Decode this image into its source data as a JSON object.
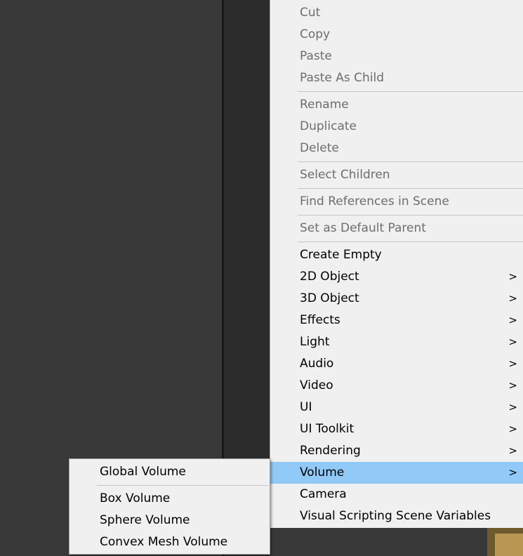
{
  "context_menu": {
    "groups": [
      [
        {
          "label": "Cut",
          "enabled": false
        },
        {
          "label": "Copy",
          "enabled": false
        },
        {
          "label": "Paste",
          "enabled": false
        },
        {
          "label": "Paste As Child",
          "enabled": false
        }
      ],
      [
        {
          "label": "Rename",
          "enabled": false
        },
        {
          "label": "Duplicate",
          "enabled": false
        },
        {
          "label": "Delete",
          "enabled": false
        }
      ],
      [
        {
          "label": "Select Children",
          "enabled": false
        }
      ],
      [
        {
          "label": "Find References in Scene",
          "enabled": false
        }
      ],
      [
        {
          "label": "Set as Default Parent",
          "enabled": false
        }
      ],
      [
        {
          "label": "Create Empty",
          "enabled": true,
          "submenu": false
        },
        {
          "label": "2D Object",
          "enabled": true,
          "submenu": true
        },
        {
          "label": "3D Object",
          "enabled": true,
          "submenu": true
        },
        {
          "label": "Effects",
          "enabled": true,
          "submenu": true
        },
        {
          "label": "Light",
          "enabled": true,
          "submenu": true
        },
        {
          "label": "Audio",
          "enabled": true,
          "submenu": true
        },
        {
          "label": "Video",
          "enabled": true,
          "submenu": true
        },
        {
          "label": "UI",
          "enabled": true,
          "submenu": true
        },
        {
          "label": "UI Toolkit",
          "enabled": true,
          "submenu": true
        },
        {
          "label": "Rendering",
          "enabled": true,
          "submenu": true
        },
        {
          "label": "Volume",
          "enabled": true,
          "submenu": true,
          "highlighted": true
        },
        {
          "label": "Camera",
          "enabled": true,
          "submenu": false
        },
        {
          "label": "Visual Scripting Scene Variables",
          "enabled": true,
          "submenu": false
        }
      ]
    ],
    "submenu_arrow": ">"
  },
  "volume_submenu": {
    "groups": [
      [
        {
          "label": "Global Volume"
        }
      ],
      [
        {
          "label": "Box Volume"
        },
        {
          "label": "Sphere Volume"
        },
        {
          "label": "Convex Mesh Volume"
        }
      ]
    ]
  },
  "colors": {
    "menu_bg": "#f0f0f0",
    "highlight": "#91c9f7",
    "disabled_text": "#6d6d6d",
    "editor_bg": "#383838"
  }
}
